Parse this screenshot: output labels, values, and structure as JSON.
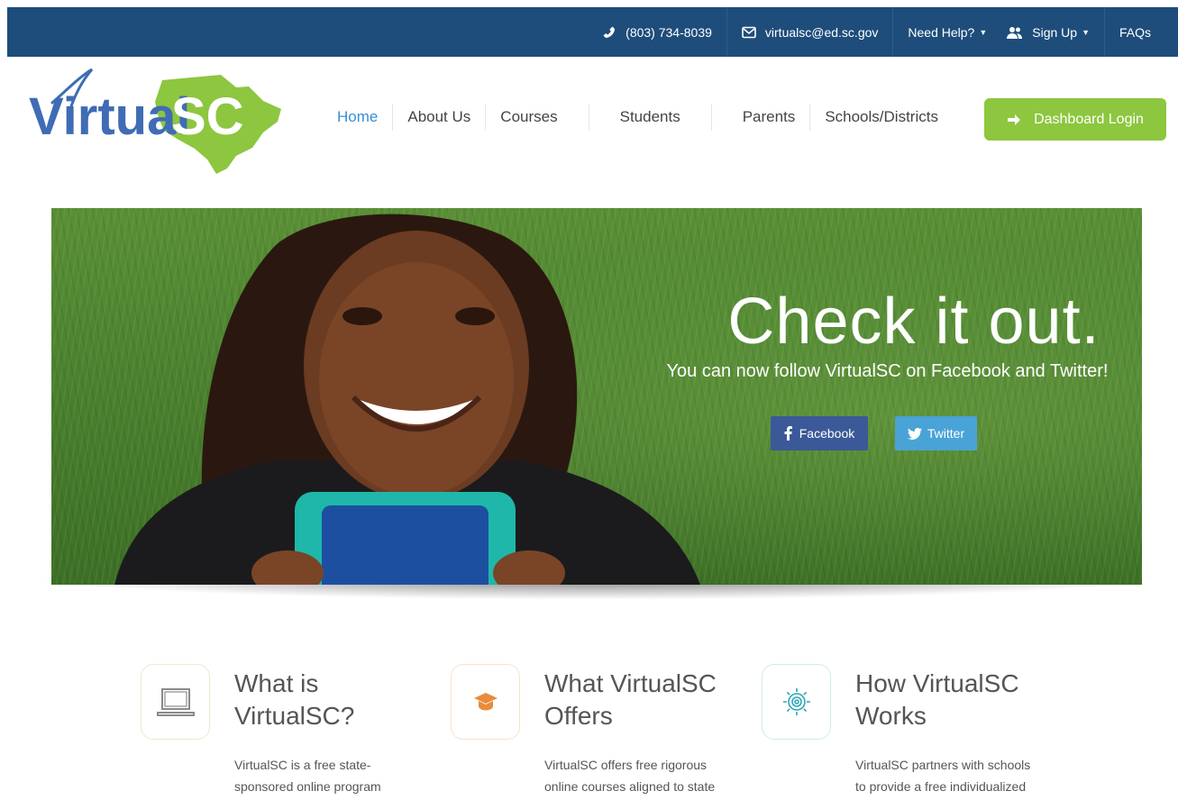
{
  "topbar": {
    "phone": "(803) 734-8039",
    "email": "virtualsc@ed.sc.gov",
    "help": "Need Help?",
    "signup": "Sign Up",
    "faqs": "FAQs"
  },
  "logo": {
    "text_virtual": "Virtual",
    "text_sc": "SC"
  },
  "nav": {
    "items": [
      {
        "label": "Home",
        "active": true
      },
      {
        "label": "About Us"
      },
      {
        "label": "Courses"
      },
      {
        "label": "Students"
      },
      {
        "label": "Parents"
      },
      {
        "label": "Schools/Districts"
      }
    ],
    "dashboard_login": "Dashboard Login"
  },
  "hero": {
    "title": "Check it out.",
    "subtitle": "You can now follow VirtualSC on Facebook and Twitter!",
    "facebook_label": "Facebook",
    "twitter_label": "Twitter"
  },
  "features": [
    {
      "title": "What is VirtualSC?",
      "text": "VirtualSC is a free state-sponsored online program",
      "icon": "laptop-icon"
    },
    {
      "title": "What VirtualSC Offers",
      "text": "VirtualSC offers free rigorous online courses aligned to state",
      "icon": "graduation-cap-icon"
    },
    {
      "title": "How VirtualSC Works",
      "text": "VirtualSC partners with schools to provide a free individualized",
      "icon": "gear-icon"
    }
  ],
  "colors": {
    "topbar": "#1e4d7b",
    "accent_green": "#8dc63f",
    "link_blue": "#3a8fd1",
    "facebook": "#3b5998",
    "twitter": "#4aa3d6"
  }
}
